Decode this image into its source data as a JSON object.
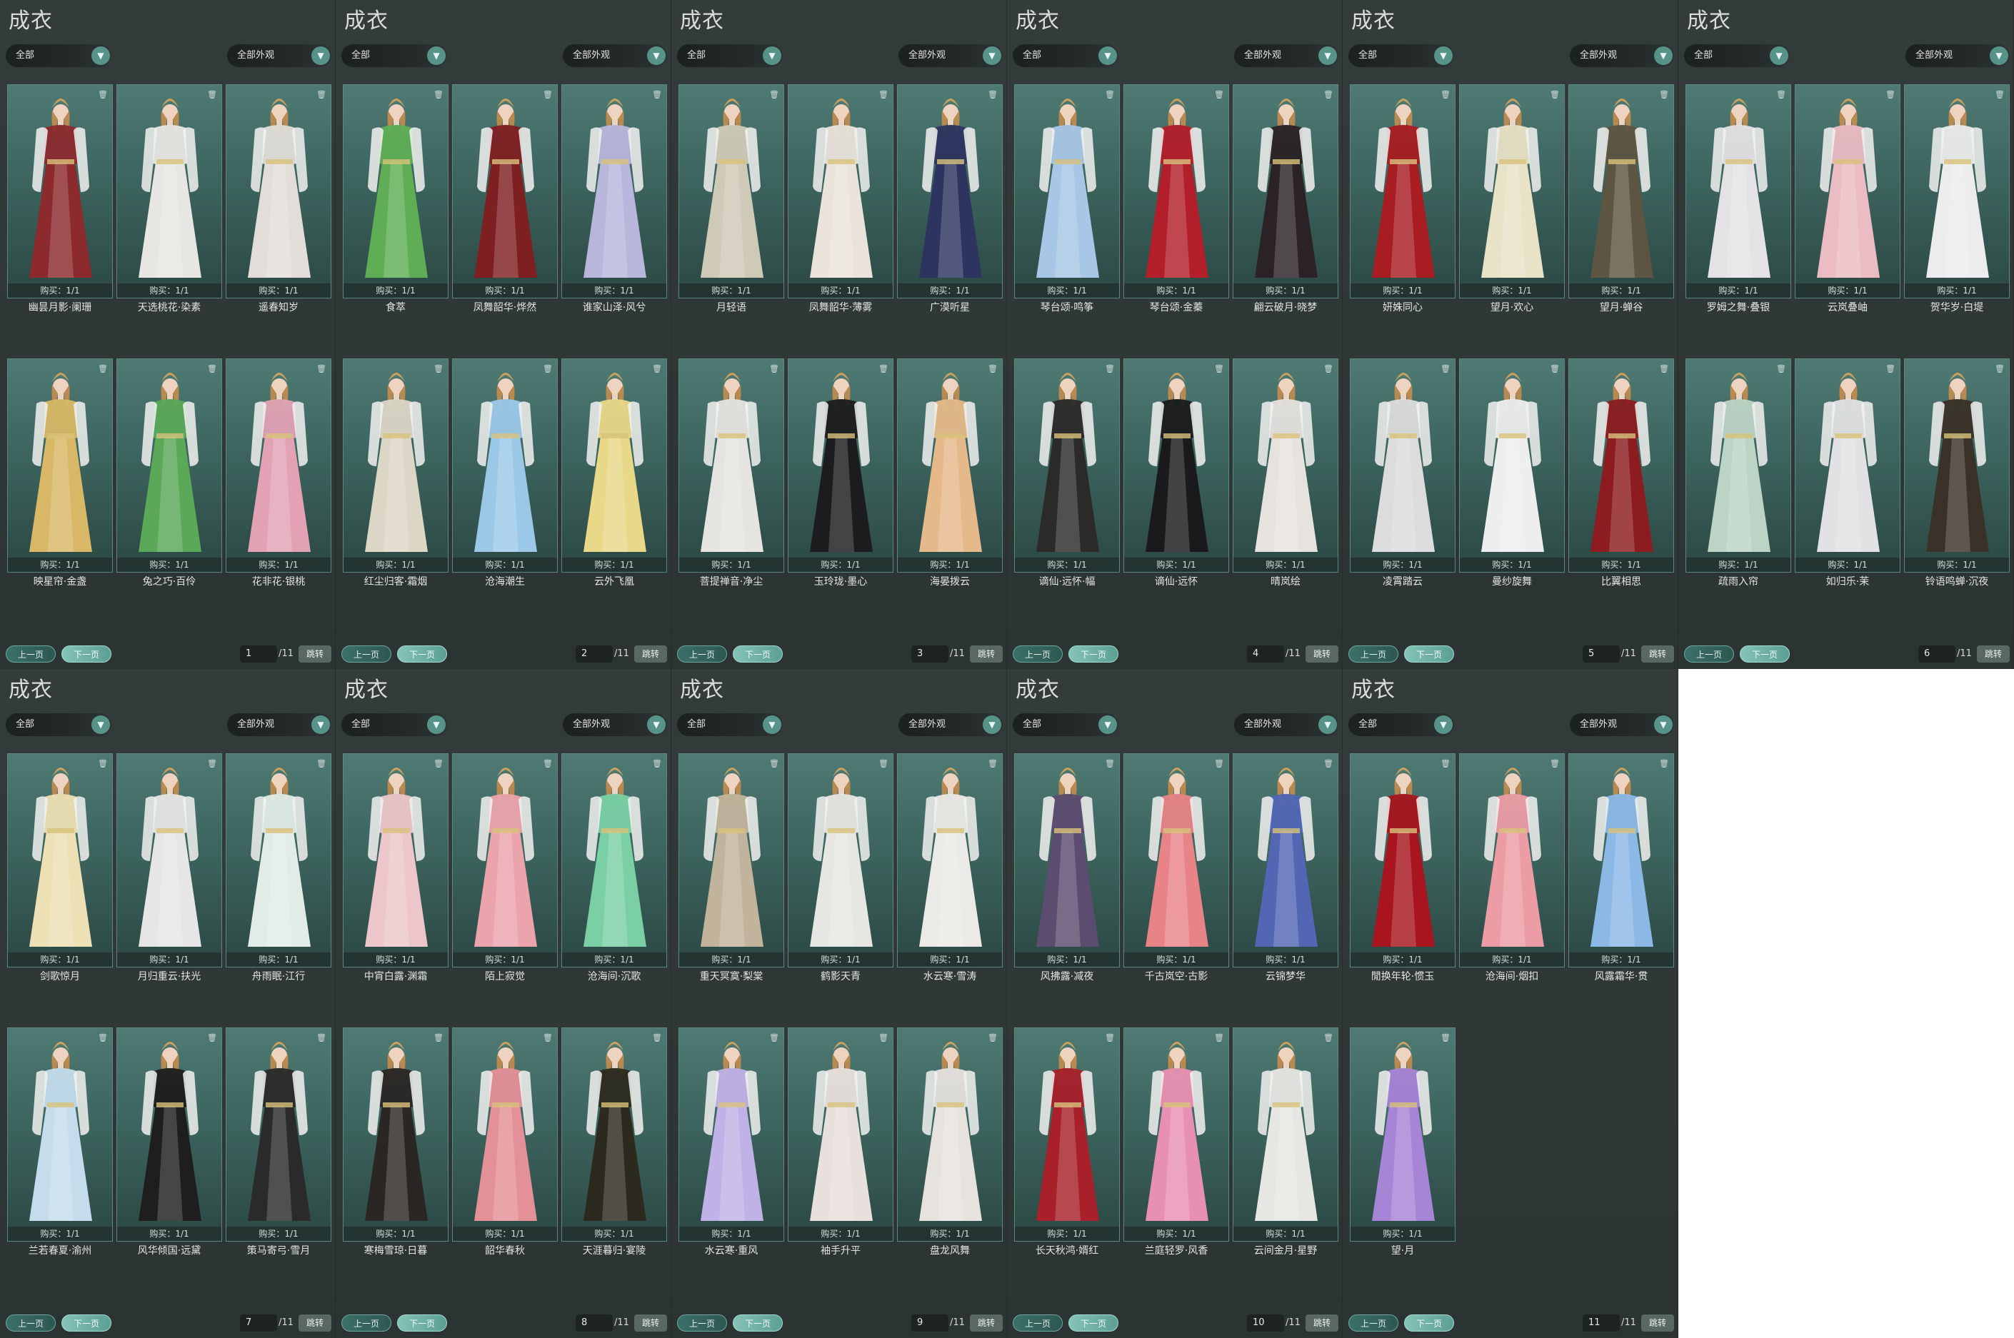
{
  "app": {
    "title": "成衣",
    "filter_left": "全部",
    "filter_right": "全部外观",
    "prev_label": "上一页",
    "next_label": "下一页",
    "jump_label": "跳转",
    "total_pages": "/11",
    "dropdown_icon": "chevron-down-icon",
    "delete_icon": "trash-icon",
    "colors": {
      "panel_bg": "#313938",
      "accent": "#58938a",
      "card_bg": "#3d645e"
    }
  },
  "panels": [
    {
      "page": "1",
      "items": [
        {
          "name": "幽昙月影·阑珊",
          "buy": "购买：1/1",
          "color": "#8c2a2e"
        },
        {
          "name": "天选桃花·染素",
          "buy": "购买：1/1",
          "color": "#e8e6e2"
        },
        {
          "name": "遥春知岁",
          "buy": "购买：1/1",
          "color": "#e2ddd8"
        },
        {
          "name": "映星帘·金盏",
          "buy": "购买：1/1",
          "color": "#d8b866"
        },
        {
          "name": "兔之巧·百伶",
          "buy": "购买：1/1",
          "color": "#5aa858"
        },
        {
          "name": "花非花·银桃",
          "buy": "购买：1/1",
          "color": "#e2a2b4"
        }
      ]
    },
    {
      "page": "2",
      "items": [
        {
          "name": "食萃",
          "buy": "购买：1/1",
          "color": "#5fae55"
        },
        {
          "name": "凤舞韶华·烨然",
          "buy": "购买：1/1",
          "color": "#7e1f22"
        },
        {
          "name": "谁家山泽·风兮",
          "buy": "购买：1/1",
          "color": "#b9b6dc"
        },
        {
          "name": "红尘归客·霜烟",
          "buy": "购买：1/1",
          "color": "#dcd6c6"
        },
        {
          "name": "沧海潮生",
          "buy": "购买：1/1",
          "color": "#9cc8e8"
        },
        {
          "name": "云外飞凰",
          "buy": "购买：1/1",
          "color": "#e8d888"
        }
      ]
    },
    {
      "page": "3",
      "items": [
        {
          "name": "月轻语",
          "buy": "购买：1/1",
          "color": "#cfc9b8"
        },
        {
          "name": "凤舞韶华·薄雾",
          "buy": "购买：1/1",
          "color": "#eae3db"
        },
        {
          "name": "广漠听星",
          "buy": "购买：1/1",
          "color": "#2d3460"
        },
        {
          "name": "菩提禅音·净尘",
          "buy": "购买：1/1",
          "color": "#e6e4e0"
        },
        {
          "name": "玉玲珑·墨心",
          "buy": "购买：1/1",
          "color": "#1c1c1e"
        },
        {
          "name": "海晏拨云",
          "buy": "购买：1/1",
          "color": "#e6b98a"
        }
      ]
    },
    {
      "page": "4",
      "items": [
        {
          "name": "琴台颂·鸣筝",
          "buy": "购买：1/1",
          "color": "#a8c6e6"
        },
        {
          "name": "琴台颂·金蓁",
          "buy": "购买：1/1",
          "color": "#b21e2a"
        },
        {
          "name": "翩云破月·晓梦",
          "buy": "购买：1/1",
          "color": "#2a2224"
        },
        {
          "name": "谪仙·远怀·幅",
          "buy": "购买：1/1",
          "color": "#2c2a28"
        },
        {
          "name": "谪仙·远怀",
          "buy": "购买：1/1",
          "color": "#1a1a1c"
        },
        {
          "name": "晴岚绘",
          "buy": "购买：1/1",
          "color": "#e6e2de"
        }
      ]
    },
    {
      "page": "5",
      "items": [
        {
          "name": "妍姝同心",
          "buy": "购买：1/1",
          "color": "#a81d22"
        },
        {
          "name": "望月·欢心",
          "buy": "购买：1/1",
          "color": "#e8e2c6"
        },
        {
          "name": "望月·蝉谷",
          "buy": "购买：1/1",
          "color": "#5e5442"
        },
        {
          "name": "凌霄踏云",
          "buy": "购买：1/1",
          "color": "#dcdcdc"
        },
        {
          "name": "曼纱旋舞",
          "buy": "购买：1/1",
          "color": "#eeeeee"
        },
        {
          "name": "比翼相思",
          "buy": "购买：1/1",
          "color": "#8c1c20"
        }
      ]
    },
    {
      "page": "6",
      "items": [
        {
          "name": "罗姆之舞·叠银",
          "buy": "购买：1/1",
          "color": "#e4e2e4"
        },
        {
          "name": "云岚叠岫",
          "buy": "购买：1/1",
          "color": "#ecbcc4"
        },
        {
          "name": "贺华岁·白堤",
          "buy": "购买：1/1",
          "color": "#ececec"
        },
        {
          "name": "疏雨入帘",
          "buy": "购买：1/1",
          "color": "#bcd4c6"
        },
        {
          "name": "如归乐·茉",
          "buy": "购买：1/1",
          "color": "#e2e2e4"
        },
        {
          "name": "铃语鸣蝉·沉夜",
          "buy": "购买：1/1",
          "color": "#3a3228"
        }
      ]
    },
    {
      "page": "7",
      "items": [
        {
          "name": "剑歌惊月",
          "buy": "购买：1/1",
          "color": "#ece0b4"
        },
        {
          "name": "月归重云·扶光",
          "buy": "购买：1/1",
          "color": "#e6e6e6"
        },
        {
          "name": "舟雨眠·江行",
          "buy": "购买：1/1",
          "color": "#e2ece6"
        },
        {
          "name": "兰若春夏·渝州",
          "buy": "购买：1/1",
          "color": "#c4dcec"
        },
        {
          "name": "风华倾国·远黛",
          "buy": "购买：1/1",
          "color": "#1e1e1e"
        },
        {
          "name": "策马寄弓·雪月",
          "buy": "购买：1/1",
          "color": "#2a2a2a"
        }
      ]
    },
    {
      "page": "8",
      "items": [
        {
          "name": "中宵白露·渊霜",
          "buy": "购买：1/1",
          "color": "#ecc6ca"
        },
        {
          "name": "陌上寂觉",
          "buy": "购买：1/1",
          "color": "#eca4ac"
        },
        {
          "name": "沧海间·沉歌",
          "buy": "购买：1/1",
          "color": "#7ad0a4"
        },
        {
          "name": "寒梅雪琼·日暮",
          "buy": "购买：1/1",
          "color": "#2a2624"
        },
        {
          "name": "韶华春秋",
          "buy": "购买：1/1",
          "color": "#e49098"
        },
        {
          "name": "天涯暮归·宴陵",
          "buy": "购买：1/1",
          "color": "#2c2a1e"
        }
      ]
    },
    {
      "page": "9",
      "items": [
        {
          "name": "重天冥寞·梨棠",
          "buy": "购买：1/1",
          "color": "#c2b49c"
        },
        {
          "name": "鹤影天青",
          "buy": "购买：1/1",
          "color": "#e6e6e2"
        },
        {
          "name": "水云寒·雪涛",
          "buy": "购买：1/1",
          "color": "#eceae6"
        },
        {
          "name": "水云寒·重风",
          "buy": "购买：1/1",
          "color": "#c0b2e6"
        },
        {
          "name": "袖手升平",
          "buy": "购买：1/1",
          "color": "#e8e0dc"
        },
        {
          "name": "盘龙风舞",
          "buy": "购买：1/1",
          "color": "#e6e2de"
        }
      ]
    },
    {
      "page": "10",
      "items": [
        {
          "name": "风拂露·减夜",
          "buy": "购买：1/1",
          "color": "#5c4c70"
        },
        {
          "name": "千古岚空·古影",
          "buy": "购买：1/1",
          "color": "#e88488"
        },
        {
          "name": "云锦梦华",
          "buy": "购买：1/1",
          "color": "#5266b4"
        },
        {
          "name": "长天秋鸿·婿红",
          "buy": "购买：1/1",
          "color": "#a8202a"
        },
        {
          "name": "兰庭轻罗·风香",
          "buy": "购买：1/1",
          "color": "#e890b4"
        },
        {
          "name": "云间金月·星野",
          "buy": "购买：1/1",
          "color": "#e6e6e2"
        }
      ]
    },
    {
      "page": "11",
      "items": [
        {
          "name": "閒换年轮·惯玉",
          "buy": "购买：1/1",
          "color": "#a8151e"
        },
        {
          "name": "沧海间·烟扣",
          "buy": "购买：1/1",
          "color": "#ec9ca4"
        },
        {
          "name": "风露霜华·贯",
          "buy": "购买：1/1",
          "color": "#8cb8e6"
        },
        {
          "name": "望·月",
          "buy": "购买：1/1",
          "color": "#a684d6"
        }
      ]
    }
  ]
}
